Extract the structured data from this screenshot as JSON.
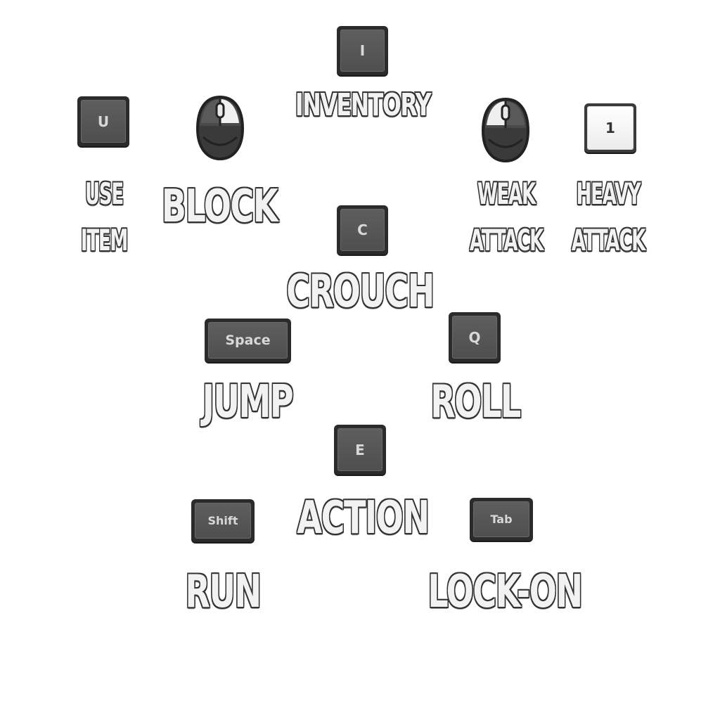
{
  "controls": {
    "inventory": {
      "key": "I",
      "label": "INVENTORY"
    },
    "use_item": {
      "key": "U",
      "label_line1": "USE",
      "label_line2": "ITEM"
    },
    "block": {
      "input": "mouse-right-icon",
      "label": "BLOCK"
    },
    "weak_attack": {
      "input": "mouse-left-icon",
      "label_line1": "WEAK",
      "label_line2": "ATTACK"
    },
    "heavy_attack": {
      "key": "1",
      "label_line1": "HEAVY",
      "label_line2": "ATTACK"
    },
    "crouch": {
      "key": "C",
      "label": "CROUCH"
    },
    "jump": {
      "key": "Space",
      "label": "JUMP"
    },
    "roll": {
      "key": "Q",
      "label": "ROLL"
    },
    "action": {
      "key": "E",
      "label": "ACTION"
    },
    "run": {
      "key": "Shift",
      "label": "RUN"
    },
    "lock_on": {
      "key": "Tab",
      "label": "LOCK-ON"
    }
  },
  "colors": {
    "key_body": "#2b2b2b",
    "key_face": "#565656",
    "key_text": "#d8d8d8",
    "label_fill": "#f2f2f2",
    "label_outline": "#333333"
  }
}
